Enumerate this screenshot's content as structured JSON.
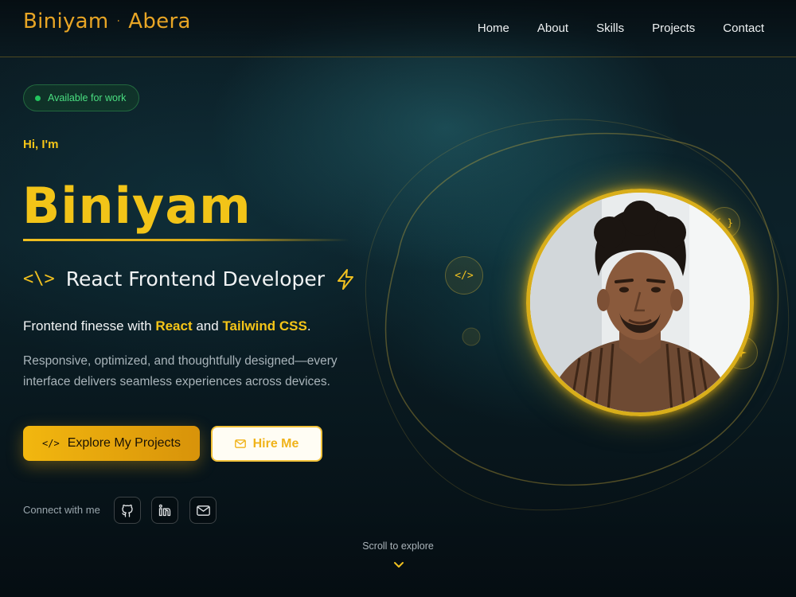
{
  "brand": {
    "first": "Biniyam",
    "dot": "·",
    "last": "Abera"
  },
  "nav": {
    "items": [
      "Home",
      "About",
      "Skills",
      "Projects",
      "Contact"
    ]
  },
  "badge": {
    "label": "Available for work"
  },
  "hero": {
    "greeting": "Hi, I'm",
    "name": "Biniyam",
    "code_glyph": "<\\>",
    "role": "React Frontend Developer",
    "tagline_prefix": "Frontend finesse with ",
    "tagline_react": "React",
    "tagline_and": " and ",
    "tagline_tailwind": "Tailwind CSS",
    "tagline_suffix": ".",
    "description": "Responsive, optimized, and thoughtfully designed—every interface delivers seamless experiences across devices."
  },
  "buttons": {
    "explore_icon": "</>",
    "explore_label": "Explore My Projects",
    "hire_label": "Hire Me"
  },
  "connect": {
    "label": "Connect with me",
    "icons": [
      "github-icon",
      "linkedin-icon",
      "mail-icon"
    ]
  },
  "floating_chips": {
    "code": "</>",
    "braces": "{ }"
  },
  "scroll": {
    "label": "Scroll to explore"
  },
  "colors": {
    "accent": "#f2c418",
    "available_green": "#4ade80",
    "background": "#0b1b22"
  }
}
